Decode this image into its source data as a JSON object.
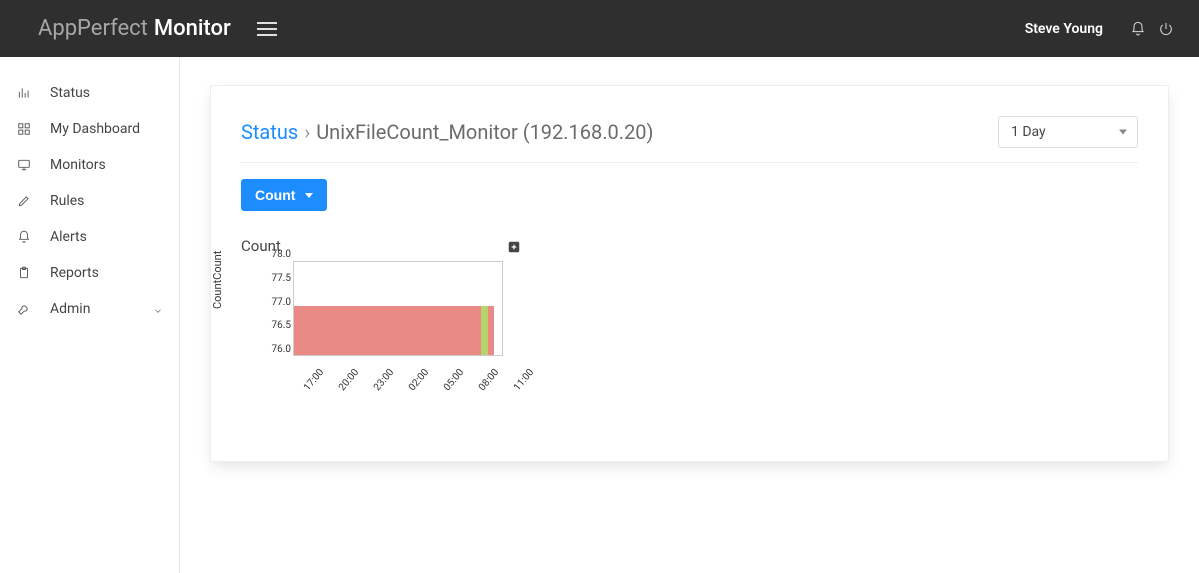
{
  "brand": {
    "prefix": "AppPerfect",
    "suffix": "Monitor"
  },
  "user": {
    "name": "Steve Young"
  },
  "sidebar": {
    "items": [
      {
        "label": "Status",
        "icon": "bar-chart-icon"
      },
      {
        "label": "My Dashboard",
        "icon": "grid-icon"
      },
      {
        "label": "Monitors",
        "icon": "monitor-icon"
      },
      {
        "label": "Rules",
        "icon": "pencil-icon"
      },
      {
        "label": "Alerts",
        "icon": "bell-icon"
      },
      {
        "label": "Reports",
        "icon": "clipboard-icon"
      },
      {
        "label": "Admin",
        "icon": "wrench-icon",
        "expandable": true
      }
    ]
  },
  "breadcrumb": {
    "root": "Status",
    "current": "UnixFileCount_Monitor (192.168.0.20)"
  },
  "time_range": {
    "selected": "1 Day"
  },
  "tab_button": {
    "label": "Count"
  },
  "chart_data": {
    "type": "area",
    "title": "Count",
    "ylabel": "CountCount",
    "ylim": [
      76.0,
      78.0
    ],
    "y_ticks": [
      76.0,
      76.5,
      77.0,
      77.5,
      78.0
    ],
    "x_ticks": [
      "17:00",
      "20:00",
      "23:00",
      "02:00",
      "05:00",
      "08:00",
      "11:00"
    ],
    "series": [
      {
        "name": "Count",
        "segments": [
          {
            "from": "17:00",
            "to": "09:00",
            "value": 77.0,
            "status": "red"
          },
          {
            "from": "09:00",
            "to": "09:40",
            "value": 77.0,
            "status": "green"
          },
          {
            "from": "09:40",
            "to": "10:10",
            "value": 77.0,
            "status": "red"
          }
        ]
      }
    ]
  }
}
